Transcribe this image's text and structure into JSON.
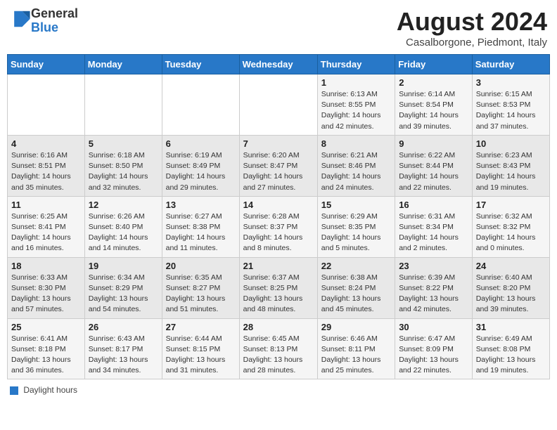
{
  "header": {
    "logo_general": "General",
    "logo_blue": "Blue",
    "month_year": "August 2024",
    "location": "Casalborgone, Piedmont, Italy"
  },
  "days_of_week": [
    "Sunday",
    "Monday",
    "Tuesday",
    "Wednesday",
    "Thursday",
    "Friday",
    "Saturday"
  ],
  "weeks": [
    [
      {
        "day": "",
        "info": ""
      },
      {
        "day": "",
        "info": ""
      },
      {
        "day": "",
        "info": ""
      },
      {
        "day": "",
        "info": ""
      },
      {
        "day": "1",
        "info": "Sunrise: 6:13 AM\nSunset: 8:55 PM\nDaylight: 14 hours\nand 42 minutes."
      },
      {
        "day": "2",
        "info": "Sunrise: 6:14 AM\nSunset: 8:54 PM\nDaylight: 14 hours\nand 39 minutes."
      },
      {
        "day": "3",
        "info": "Sunrise: 6:15 AM\nSunset: 8:53 PM\nDaylight: 14 hours\nand 37 minutes."
      }
    ],
    [
      {
        "day": "4",
        "info": "Sunrise: 6:16 AM\nSunset: 8:51 PM\nDaylight: 14 hours\nand 35 minutes."
      },
      {
        "day": "5",
        "info": "Sunrise: 6:18 AM\nSunset: 8:50 PM\nDaylight: 14 hours\nand 32 minutes."
      },
      {
        "day": "6",
        "info": "Sunrise: 6:19 AM\nSunset: 8:49 PM\nDaylight: 14 hours\nand 29 minutes."
      },
      {
        "day": "7",
        "info": "Sunrise: 6:20 AM\nSunset: 8:47 PM\nDaylight: 14 hours\nand 27 minutes."
      },
      {
        "day": "8",
        "info": "Sunrise: 6:21 AM\nSunset: 8:46 PM\nDaylight: 14 hours\nand 24 minutes."
      },
      {
        "day": "9",
        "info": "Sunrise: 6:22 AM\nSunset: 8:44 PM\nDaylight: 14 hours\nand 22 minutes."
      },
      {
        "day": "10",
        "info": "Sunrise: 6:23 AM\nSunset: 8:43 PM\nDaylight: 14 hours\nand 19 minutes."
      }
    ],
    [
      {
        "day": "11",
        "info": "Sunrise: 6:25 AM\nSunset: 8:41 PM\nDaylight: 14 hours\nand 16 minutes."
      },
      {
        "day": "12",
        "info": "Sunrise: 6:26 AM\nSunset: 8:40 PM\nDaylight: 14 hours\nand 14 minutes."
      },
      {
        "day": "13",
        "info": "Sunrise: 6:27 AM\nSunset: 8:38 PM\nDaylight: 14 hours\nand 11 minutes."
      },
      {
        "day": "14",
        "info": "Sunrise: 6:28 AM\nSunset: 8:37 PM\nDaylight: 14 hours\nand 8 minutes."
      },
      {
        "day": "15",
        "info": "Sunrise: 6:29 AM\nSunset: 8:35 PM\nDaylight: 14 hours\nand 5 minutes."
      },
      {
        "day": "16",
        "info": "Sunrise: 6:31 AM\nSunset: 8:34 PM\nDaylight: 14 hours\nand 2 minutes."
      },
      {
        "day": "17",
        "info": "Sunrise: 6:32 AM\nSunset: 8:32 PM\nDaylight: 14 hours\nand 0 minutes."
      }
    ],
    [
      {
        "day": "18",
        "info": "Sunrise: 6:33 AM\nSunset: 8:30 PM\nDaylight: 13 hours\nand 57 minutes."
      },
      {
        "day": "19",
        "info": "Sunrise: 6:34 AM\nSunset: 8:29 PM\nDaylight: 13 hours\nand 54 minutes."
      },
      {
        "day": "20",
        "info": "Sunrise: 6:35 AM\nSunset: 8:27 PM\nDaylight: 13 hours\nand 51 minutes."
      },
      {
        "day": "21",
        "info": "Sunrise: 6:37 AM\nSunset: 8:25 PM\nDaylight: 13 hours\nand 48 minutes."
      },
      {
        "day": "22",
        "info": "Sunrise: 6:38 AM\nSunset: 8:24 PM\nDaylight: 13 hours\nand 45 minutes."
      },
      {
        "day": "23",
        "info": "Sunrise: 6:39 AM\nSunset: 8:22 PM\nDaylight: 13 hours\nand 42 minutes."
      },
      {
        "day": "24",
        "info": "Sunrise: 6:40 AM\nSunset: 8:20 PM\nDaylight: 13 hours\nand 39 minutes."
      }
    ],
    [
      {
        "day": "25",
        "info": "Sunrise: 6:41 AM\nSunset: 8:18 PM\nDaylight: 13 hours\nand 36 minutes."
      },
      {
        "day": "26",
        "info": "Sunrise: 6:43 AM\nSunset: 8:17 PM\nDaylight: 13 hours\nand 34 minutes."
      },
      {
        "day": "27",
        "info": "Sunrise: 6:44 AM\nSunset: 8:15 PM\nDaylight: 13 hours\nand 31 minutes."
      },
      {
        "day": "28",
        "info": "Sunrise: 6:45 AM\nSunset: 8:13 PM\nDaylight: 13 hours\nand 28 minutes."
      },
      {
        "day": "29",
        "info": "Sunrise: 6:46 AM\nSunset: 8:11 PM\nDaylight: 13 hours\nand 25 minutes."
      },
      {
        "day": "30",
        "info": "Sunrise: 6:47 AM\nSunset: 8:09 PM\nDaylight: 13 hours\nand 22 minutes."
      },
      {
        "day": "31",
        "info": "Sunrise: 6:49 AM\nSunset: 8:08 PM\nDaylight: 13 hours\nand 19 minutes."
      }
    ]
  ],
  "footer": {
    "daylight_label": "Daylight hours"
  }
}
